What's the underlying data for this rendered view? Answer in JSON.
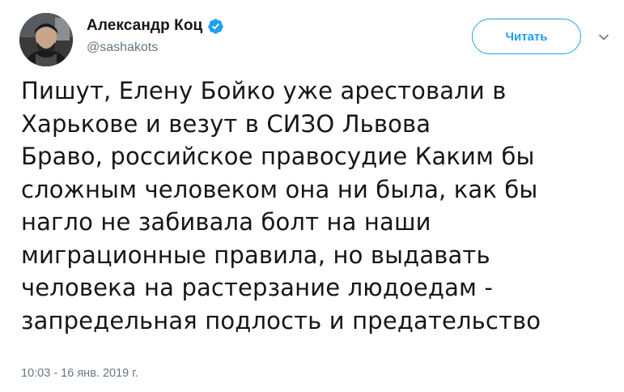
{
  "tweet": {
    "author": {
      "display_name": "Александр Коц",
      "handle": "@sashakots",
      "verified": true
    },
    "follow_button_label": "Читать",
    "text": "Пишут, Елену Бойко уже арестовали в Харькове и везут в СИЗО Львова\nБраво, российское правосудие Каким бы сложным человеком она ни была, как бы нагло не забивала болт на наши миграционные правила, но выдавать человека на растерзание людоедам - запредельная подлость и предательство",
    "timestamp": "10:03 - 16 янв. 2019 г."
  },
  "colors": {
    "accent": "#1da1f2",
    "text": "#14171a",
    "secondary_text": "#657786"
  },
  "icons": {
    "verified": "verified-badge-icon",
    "caret": "chevron-down-icon"
  }
}
